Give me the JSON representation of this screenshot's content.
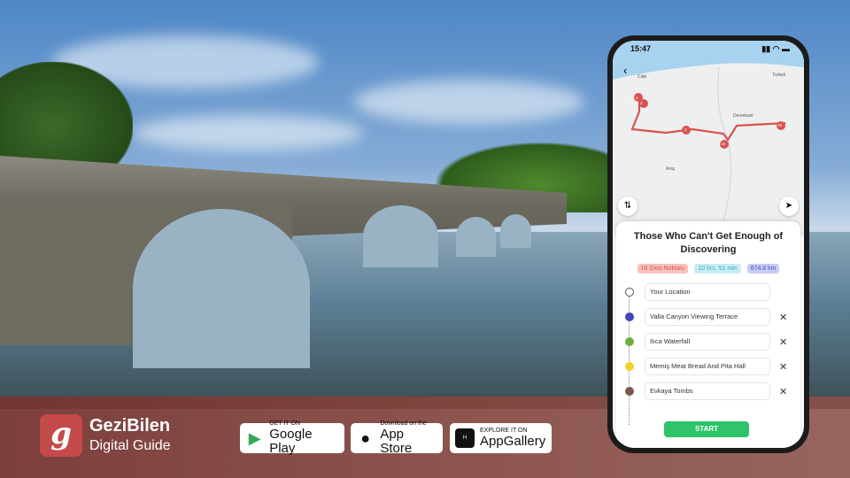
{
  "brand": {
    "name": "GeziBilen",
    "tagline": "Digital Guide",
    "logo_letter": "g"
  },
  "stores": [
    {
      "small": "GET IT ON",
      "large": "Google Play",
      "icon": "google-play-icon"
    },
    {
      "small": "Download on the",
      "large": "App Store",
      "icon": "apple-icon"
    },
    {
      "small": "EXPLORE IT ON",
      "large": "AppGallery",
      "icon": "huawei-icon"
    }
  ],
  "phone": {
    "time": "15:47",
    "map": {
      "labels": [
        "Cide",
        "Türkeli",
        "Devrekani",
        "Araç"
      ],
      "markers": [
        "1",
        "2",
        "3",
        "16",
        "18"
      ],
      "route_color": "#d9534f"
    },
    "route": {
      "title": "Those Who Can't Get Enough of Discovering",
      "stops_badge": "18 Gezi Noktası",
      "duration_badge": "10 hrs. 51 min",
      "distance_badge": "674.8 km",
      "items": [
        "Your Location",
        "Valla Canyon Viewing Terrace",
        "Ilıca Waterfall",
        "Memiş Meat Bread And Pita Hall",
        "Evkaya Tombs"
      ],
      "start_label": "START"
    }
  }
}
